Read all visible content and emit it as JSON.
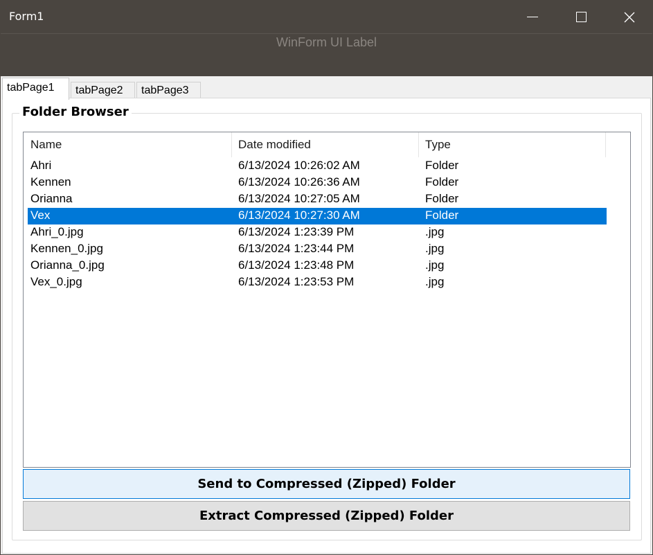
{
  "window": {
    "title": "Form1",
    "controls": {
      "minimize_icon": "minimize-icon",
      "maximize_icon": "maximize-icon",
      "close_icon": "close-icon",
      "close_glyph": "✕"
    }
  },
  "header": {
    "label": "WinForm UI Label"
  },
  "tabs": [
    {
      "label": "tabPage1",
      "active": true
    },
    {
      "label": "tabPage2",
      "active": false
    },
    {
      "label": "tabPage3",
      "active": false
    }
  ],
  "group": {
    "caption": "Folder Browser"
  },
  "listview": {
    "columns": [
      "Name",
      "Date modified",
      "Type"
    ],
    "rows": [
      {
        "name": "Ahri",
        "date": "6/13/2024 10:26:02 AM",
        "type": "Folder",
        "selected": false
      },
      {
        "name": "Kennen",
        "date": "6/13/2024 10:26:36 AM",
        "type": "Folder",
        "selected": false
      },
      {
        "name": "Orianna",
        "date": "6/13/2024 10:27:05 AM",
        "type": "Folder",
        "selected": false
      },
      {
        "name": "Vex",
        "date": "6/13/2024 10:27:30 AM",
        "type": "Folder",
        "selected": true
      },
      {
        "name": "Ahri_0.jpg",
        "date": "6/13/2024 1:23:39 PM",
        "type": ".jpg",
        "selected": false
      },
      {
        "name": "Kennen_0.jpg",
        "date": "6/13/2024 1:23:44 PM",
        "type": ".jpg",
        "selected": false
      },
      {
        "name": "Orianna_0.jpg",
        "date": "6/13/2024 1:23:48 PM",
        "type": ".jpg",
        "selected": false
      },
      {
        "name": "Vex_0.jpg",
        "date": "6/13/2024 1:23:53 PM",
        "type": ".jpg",
        "selected": false
      }
    ]
  },
  "buttons": {
    "compress": "Send to Compressed (Zipped) Folder",
    "extract": "Extract Compressed (Zipped) Folder"
  },
  "colors": {
    "titlebar": "#4a4540",
    "selection": "#0078d7",
    "primary_button_bg": "#e5f1fb",
    "secondary_button_bg": "#e1e1e1"
  }
}
